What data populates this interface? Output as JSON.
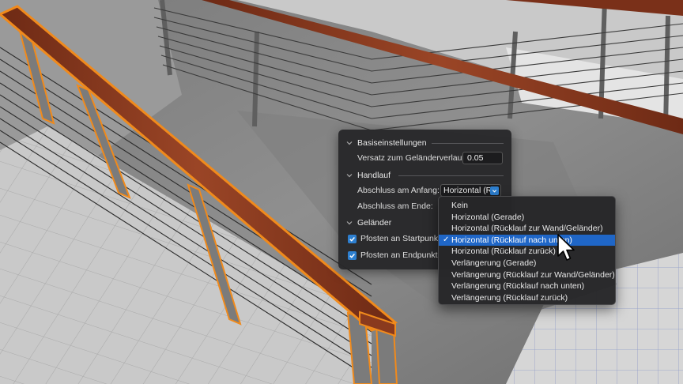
{
  "panel": {
    "basis": {
      "title": "Basiseinstellungen",
      "offset_label": "Versatz zum Geländerverlauf:",
      "offset_value": "0.05"
    },
    "handlauf": {
      "title": "Handlauf",
      "start_label": "Abschluss am Anfang:",
      "start_value": "Horizontal (R",
      "end_label": "Abschluss am Ende:"
    },
    "gelaender": {
      "title": "Geländer",
      "start_post_label": "Pfosten an Startpunkt",
      "end_post_label": "Pfosten an Endpunkt",
      "start_post_checked": true,
      "end_post_checked": true
    }
  },
  "menu": {
    "selected_index": 3,
    "items": [
      "Kein",
      "Horizontal (Gerade)",
      "Horizontal (Rücklauf zur Wand/Geländer)",
      "Horizontal (Rücklauf nach unten)",
      "Horizontal (Rücklauf zurück)",
      "Verlängerung (Gerade)",
      "Verlängerung (Rücklauf zur Wand/Geländer)",
      "Verlängerung (Rücklauf nach unten)",
      "Verlängerung (Rücklauf zurück)"
    ]
  },
  "colors": {
    "accent": "#1f66c7",
    "selection_outline": "#f08a1c",
    "wood": "#8a3a1e",
    "panel_bg": "#28282a"
  }
}
